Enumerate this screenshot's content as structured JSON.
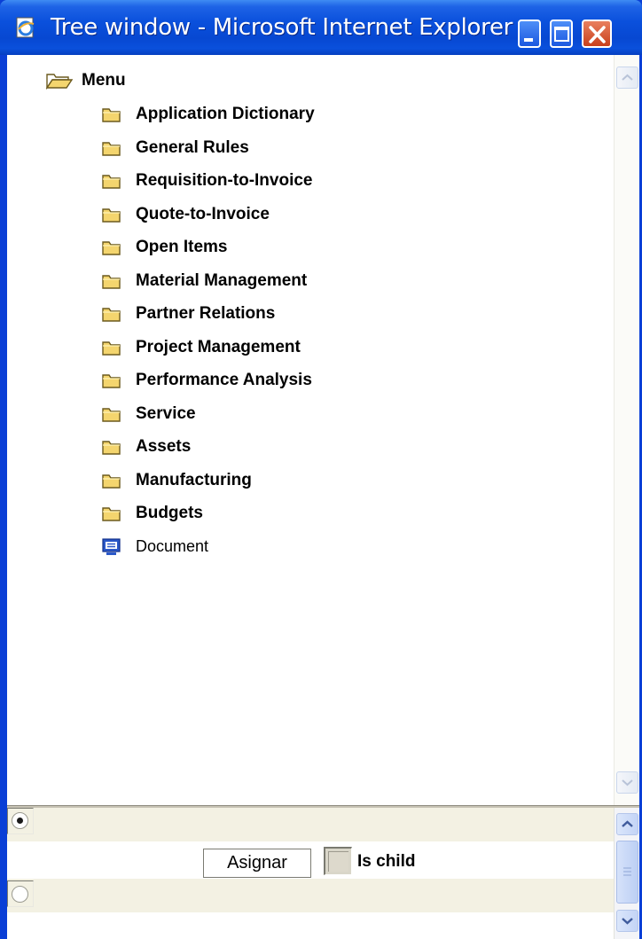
{
  "window": {
    "title": "Tree window - Microsoft Internet Explorer",
    "icon": "ie-page-icon",
    "controls": [
      "minimize-icon",
      "maximize-icon",
      "close-icon"
    ]
  },
  "tree": {
    "root": {
      "label": "Menu",
      "icon": "folder-open-icon"
    },
    "items": [
      {
        "label": "Application Dictionary",
        "icon": "folder-icon"
      },
      {
        "label": "General Rules",
        "icon": "folder-icon"
      },
      {
        "label": "Requisition-to-Invoice",
        "icon": "folder-icon"
      },
      {
        "label": "Quote-to-Invoice",
        "icon": "folder-icon"
      },
      {
        "label": "Open Items",
        "icon": "folder-icon"
      },
      {
        "label": "Material Management",
        "icon": "folder-icon"
      },
      {
        "label": "Partner Relations",
        "icon": "folder-icon"
      },
      {
        "label": "Project Management",
        "icon": "folder-icon"
      },
      {
        "label": "Performance Analysis",
        "icon": "folder-icon"
      },
      {
        "label": "Service",
        "icon": "folder-icon"
      },
      {
        "label": "Assets",
        "icon": "folder-icon"
      },
      {
        "label": "Manufacturing",
        "icon": "folder-icon"
      },
      {
        "label": "Budgets",
        "icon": "folder-icon"
      },
      {
        "label": "Document",
        "icon": "monitor-icon"
      }
    ]
  },
  "assign": {
    "button_label": "Asignar",
    "checkbox_label": "Is child",
    "checkbox_checked": false,
    "radio_top_checked": true,
    "radio_bottom_checked": false
  },
  "colors": {
    "titlebar": "#0a50dc",
    "folder": "#f4d56e",
    "band": "#f3f1e3"
  }
}
